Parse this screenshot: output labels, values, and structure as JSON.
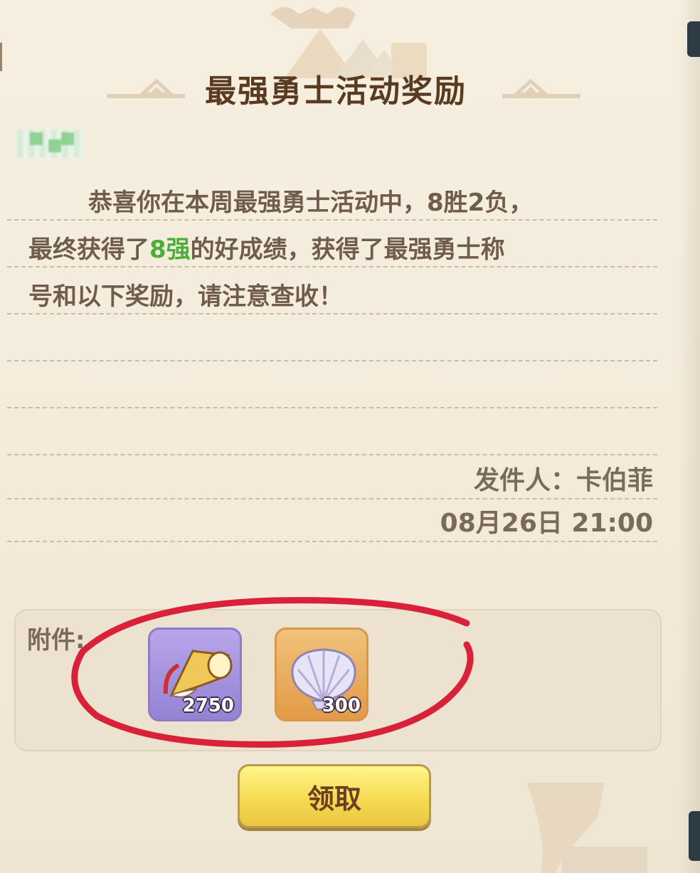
{
  "mail": {
    "title": "最强勇士活动奖励",
    "body_line1_a": "恭喜你在本周最强勇士活动中，8胜2负，",
    "body_line2_a": "最终获得了",
    "body_line2_highlight": "8强",
    "body_line2_b": "的好成绩，获得了最强勇士称",
    "body_line3": "号和以下奖励，请注意查收！",
    "sender": "发件人：卡伯菲",
    "date": "08月26日 21:00"
  },
  "attachments": {
    "label": "附件:",
    "items": [
      {
        "icon": "horn-icon",
        "quantity": "2750",
        "rarity_color": "#9482d4"
      },
      {
        "icon": "pearl-shell-icon",
        "quantity": "300",
        "rarity_color": "#e29a47"
      }
    ]
  },
  "actions": {
    "claim_label": "领取"
  },
  "colors": {
    "title": "#5a3b22",
    "highlight": "#4fae3b",
    "annotation_circle": "#d9223a"
  }
}
